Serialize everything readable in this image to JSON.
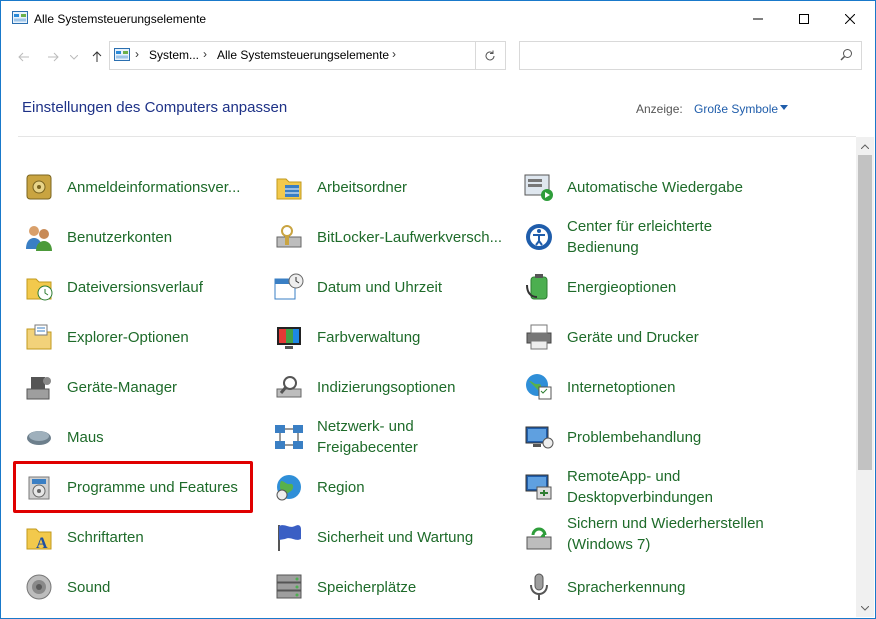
{
  "window": {
    "title": "Alle Systemsteuerungselemente"
  },
  "address": {
    "crumbs": [
      "System...",
      "Alle Systemsteuerungselemente"
    ],
    "search_placeholder": ""
  },
  "header": {
    "title": "Einstellungen des Computers anpassen",
    "view_by_label": "Anzeige:",
    "view_by_value": "Große Symbole"
  },
  "items": {
    "col1": [
      {
        "label": "Anmeldeinformationsver...",
        "icon": "credential-vault-icon"
      },
      {
        "label": "Benutzerkonten",
        "icon": "user-accounts-icon"
      },
      {
        "label": "Dateiversionsverlauf",
        "icon": "file-history-icon"
      },
      {
        "label": "Explorer-Optionen",
        "icon": "folder-options-icon"
      },
      {
        "label": "Geräte-Manager",
        "icon": "device-manager-icon"
      },
      {
        "label": "Maus",
        "icon": "mouse-icon"
      },
      {
        "label": "Programme und Features",
        "icon": "programs-features-icon"
      },
      {
        "label": "Schriftarten",
        "icon": "fonts-icon"
      },
      {
        "label": "Sound",
        "icon": "sound-icon"
      }
    ],
    "col2": [
      {
        "label": "Arbeitsordner",
        "icon": "work-folders-icon"
      },
      {
        "label": "BitLocker-Laufwerkversch...",
        "icon": "bitlocker-icon"
      },
      {
        "label": "Datum und Uhrzeit",
        "icon": "date-time-icon"
      },
      {
        "label": "Farbverwaltung",
        "icon": "color-management-icon"
      },
      {
        "label": "Indizierungsoptionen",
        "icon": "indexing-icon"
      },
      {
        "label": "Netzwerk- und Freigabecenter",
        "icon": "network-sharing-icon"
      },
      {
        "label": "Region",
        "icon": "region-globe-icon"
      },
      {
        "label": "Sicherheit und Wartung",
        "icon": "security-flag-icon"
      },
      {
        "label": "Speicherplätze",
        "icon": "storage-spaces-icon"
      }
    ],
    "col3": [
      {
        "label": "Automatische Wiedergabe",
        "icon": "autoplay-icon"
      },
      {
        "label": "Center für erleichterte Bedienung",
        "icon": "ease-of-access-icon"
      },
      {
        "label": "Energieoptionen",
        "icon": "power-options-icon"
      },
      {
        "label": "Geräte und Drucker",
        "icon": "devices-printers-icon"
      },
      {
        "label": "Internetoptionen",
        "icon": "internet-options-icon"
      },
      {
        "label": "Problembehandlung",
        "icon": "troubleshooting-icon"
      },
      {
        "label": "RemoteApp- und Desktopverbindungen",
        "icon": "remoteapp-icon"
      },
      {
        "label": "Sichern und Wiederherstellen (Windows 7)",
        "icon": "backup-restore-icon"
      },
      {
        "label": "Spracherkennung",
        "icon": "speech-recognition-icon"
      }
    ]
  },
  "colors": {
    "accent": "#1979ca",
    "link_green": "#1e6b2a",
    "heading_blue": "#1e3287",
    "highlight": "#e00000"
  }
}
